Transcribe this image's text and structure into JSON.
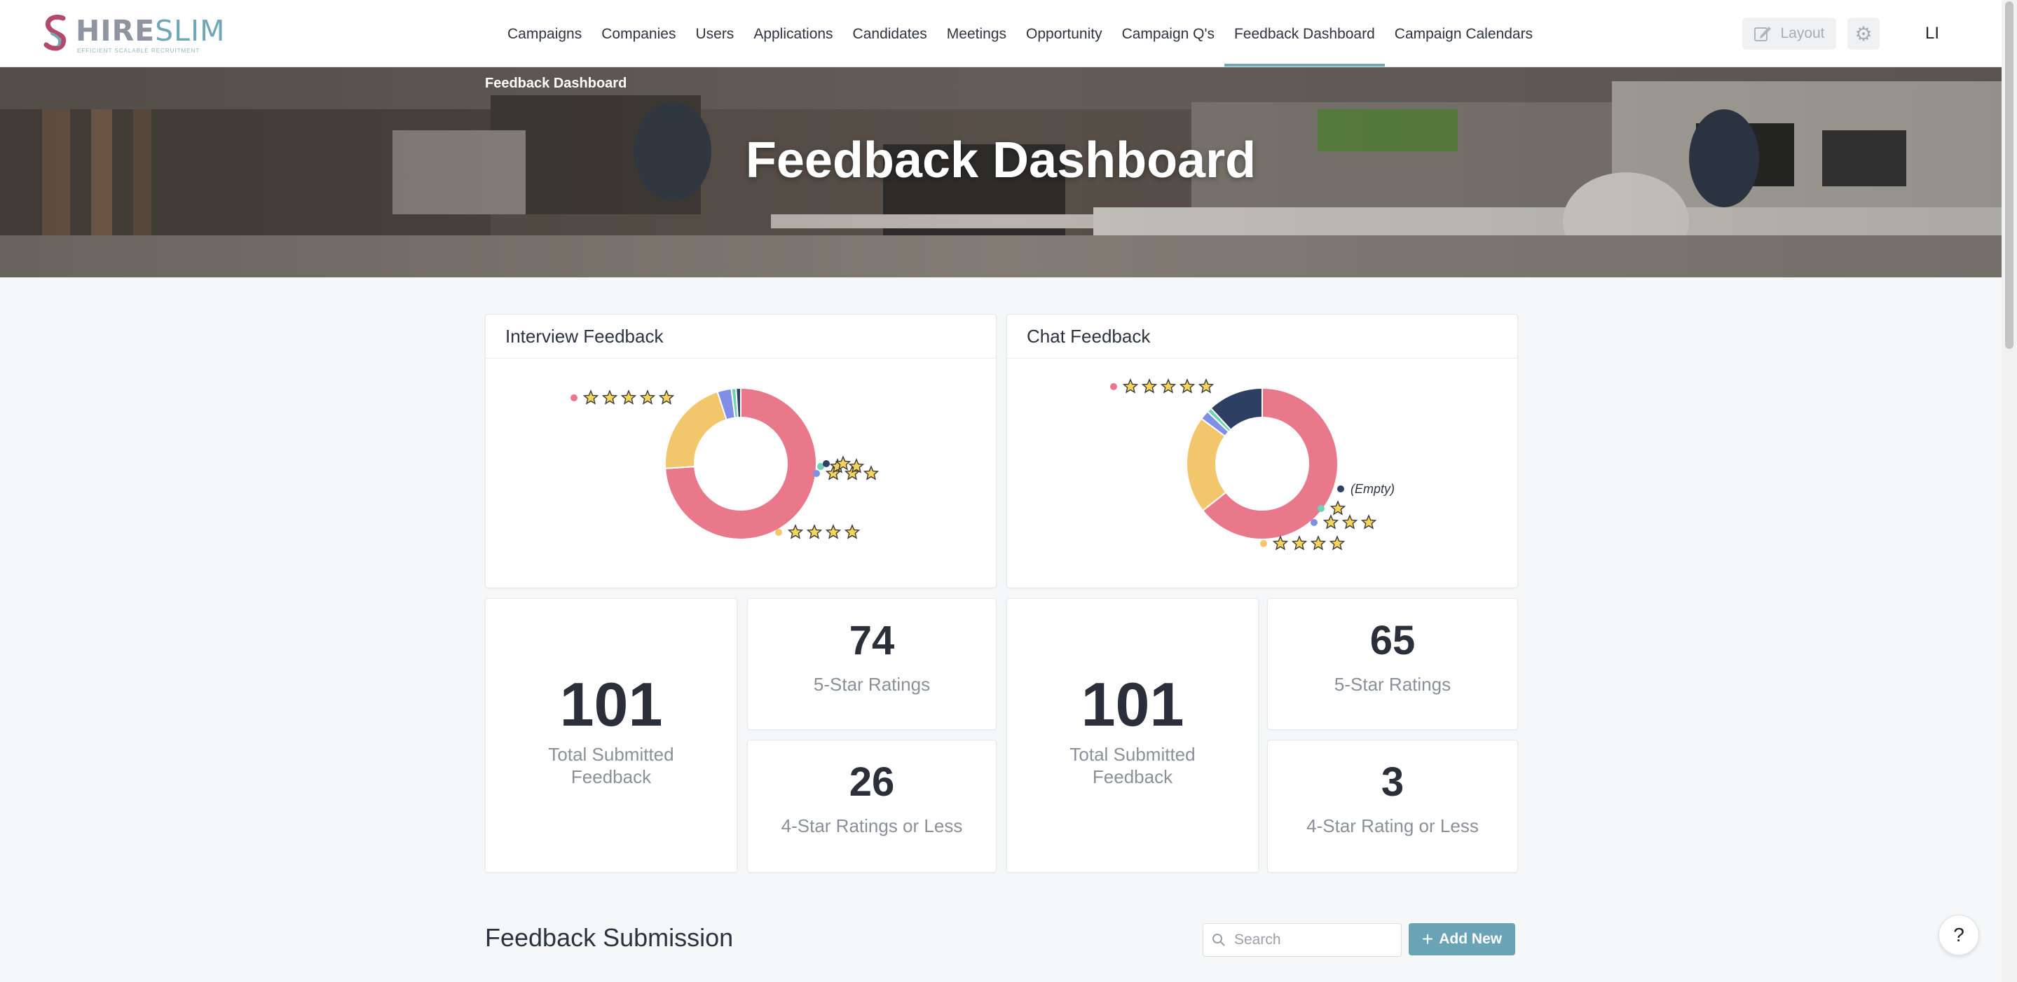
{
  "brand": {
    "name_part1": "HIRE",
    "name_part2": "SLIM",
    "tagline": "EFFICIENT SCALABLE RECRUITMENT"
  },
  "nav": {
    "items": [
      {
        "label": "Campaigns"
      },
      {
        "label": "Companies"
      },
      {
        "label": "Users"
      },
      {
        "label": "Applications"
      },
      {
        "label": "Candidates"
      },
      {
        "label": "Meetings"
      },
      {
        "label": "Opportunity"
      },
      {
        "label": "Campaign Q's"
      },
      {
        "label": "Feedback Dashboard",
        "active": true
      },
      {
        "label": "Campaign Calendars"
      }
    ],
    "layout_label": "Layout",
    "user_initials": "LI"
  },
  "hero": {
    "breadcrumb": "Feedback Dashboard",
    "title": "Feedback Dashboard"
  },
  "interview": {
    "title": "Interview Feedback",
    "total": "101",
    "total_label": "Total Submitted Feedback",
    "five_star": "74",
    "five_star_label": "5-Star Ratings",
    "four_or_less": "26",
    "four_or_less_label": "4-Star Ratings or Less"
  },
  "chat": {
    "title": "Chat Feedback",
    "total": "101",
    "total_label": "Total Submitted Feedback",
    "five_star": "65",
    "five_star_label": "5-Star Ratings",
    "four_or_less": "3",
    "four_or_less_label": "4-Star Rating or Less"
  },
  "chart_data": [
    {
      "type": "pie",
      "title": "Interview Feedback",
      "categories": [
        "★★★★★",
        "★★★★",
        "★★★",
        "★★",
        "★"
      ],
      "values": [
        74,
        21,
        3,
        1,
        1
      ],
      "colors": [
        "#e8788a",
        "#f2c76b",
        "#7f8fe6",
        "#6ed3b6",
        "#2d3f63"
      ],
      "legend_stars": [
        5,
        4,
        3,
        2,
        1
      ]
    },
    {
      "type": "pie",
      "title": "Chat Feedback",
      "categories": [
        "★★★★★",
        "★★★★",
        "★★★",
        "★",
        "(Empty)"
      ],
      "values": [
        65,
        21,
        2,
        1,
        12
      ],
      "colors": [
        "#e8788a",
        "#f2c76b",
        "#7f8fe6",
        "#6ed3b6",
        "#2d3f63"
      ],
      "legend_stars": [
        5,
        4,
        3,
        1,
        0
      ],
      "empty_label": "(Empty)"
    }
  ],
  "submission": {
    "title": "Feedback Submission",
    "search_placeholder": "Search",
    "add_label": "Add New"
  },
  "help_label": "?"
}
